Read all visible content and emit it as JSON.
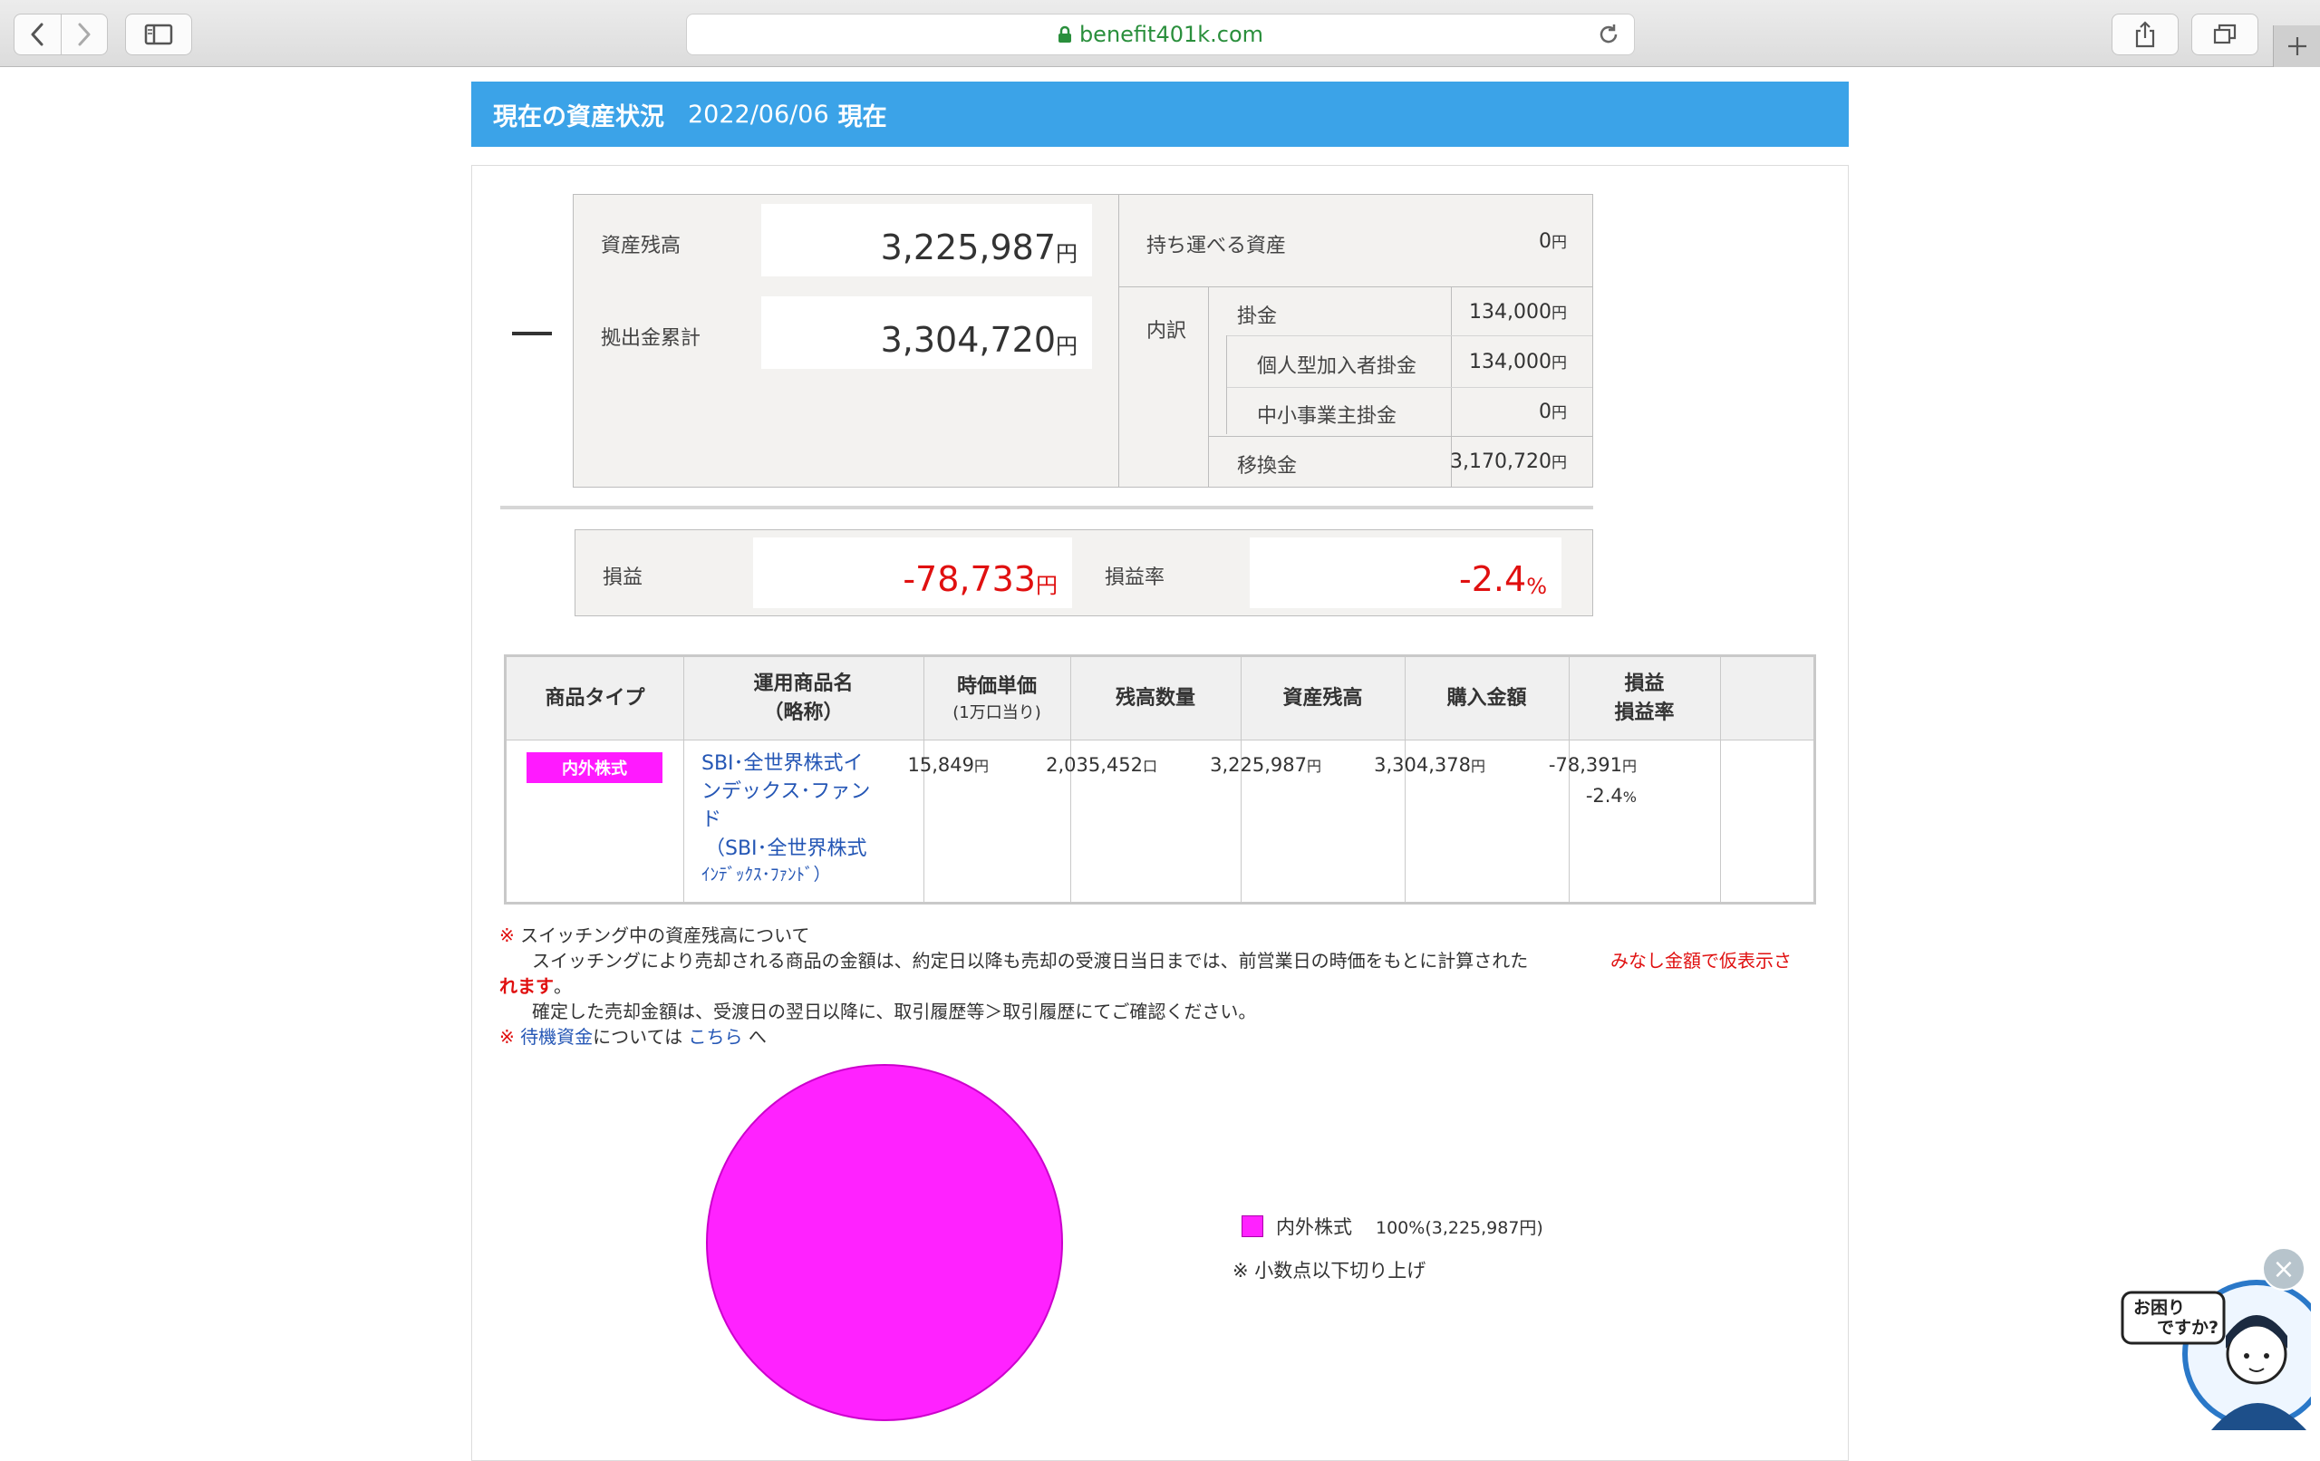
{
  "browser": {
    "url": "benefit401k.com"
  },
  "header": {
    "title": "現在の資産状況",
    "date": "2022/06/06",
    "date_suffix": "現在"
  },
  "summary": {
    "balance_label": "資産残高",
    "balance_value": "3,225,987",
    "contrib_label": "拠出金累計",
    "contrib_value": "3,304,720",
    "portable_label": "持ち運べる資産",
    "portable_value": "0",
    "breakdown_label": "内訳",
    "kakekin_label": "掛金",
    "kakekin_value": "134,000",
    "personal_label": "個人型加入者掛金",
    "personal_value": "134,000",
    "employer_label": "中小事業主掛金",
    "employer_value": "0",
    "transfer_label": "移換金",
    "transfer_value": "3,170,720",
    "yen": "円"
  },
  "profit_loss": {
    "pl_label": "損益",
    "pl_value": "-78,733",
    "rate_label": "損益率",
    "rate_value": "-2.4",
    "percent": "%"
  },
  "table": {
    "headers": {
      "type": "商品タイプ",
      "name_1": "運用商品名",
      "name_2": "（略称）",
      "price_1": "時価単価",
      "price_2": "(1万口当り)",
      "quantity": "残高数量",
      "balance": "資産残高",
      "purchase": "購入金額",
      "pl_1": "損益",
      "pl_2": "損益率"
    },
    "row": {
      "type": "内外株式",
      "name_1": "SBI･全世界株式イ",
      "name_2": "ンデックス･ファン",
      "name_3": "ド",
      "name_4": "（SBI･全世界株式",
      "name_5": "ｲﾝﾃﾞｯｸｽ･ﾌｧﾝﾄﾞ）",
      "price": "15,849",
      "quantity": "2,035,452",
      "quantity_unit": "口",
      "balance": "3,225,987",
      "purchase": "3,304,378",
      "pl": "-78,391",
      "rate": "-2.4",
      "yen": "円",
      "percent": "%"
    }
  },
  "notes": {
    "mark": "※",
    "switching_title": "スイッチング中の資産残高について",
    "switching_body": "スイッチングにより売却される商品の金額は、約定日以降も売却の受渡日当日までは、前営業日の時価をもとに計算された",
    "switching_red": "みなし金額で仮表示さ",
    "switching_red_2": "れます",
    "switching_end": "。",
    "confirmed": "確定した売却金額は、受渡日の翌日以降に、取引履歴等＞取引履歴にてご確認ください。",
    "standby_link": "待機資金",
    "standby_mid": "については",
    "here_link": "こちら",
    "standby_end": "へ"
  },
  "chart_data": {
    "type": "pie",
    "categories": [
      "内外株式"
    ],
    "values": [
      100
    ],
    "legend_label": "内外株式",
    "legend_detail": "100%(3,225,987円)",
    "footnote": "※ 小数点以下切り上げ",
    "colors": [
      "#ff22ff"
    ]
  },
  "help": {
    "line1": "お困り",
    "line2": "ですか?"
  }
}
